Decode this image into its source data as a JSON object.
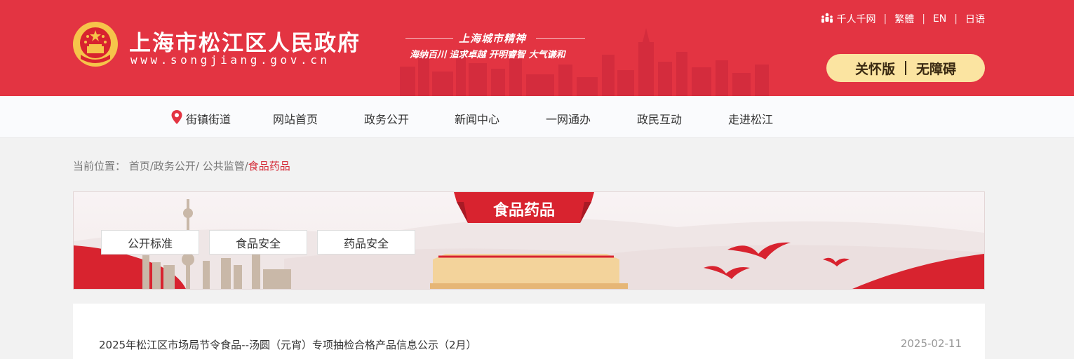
{
  "header": {
    "site_name": "上海市松江区人民政府",
    "site_url": "www.songjiang.gov.cn",
    "slogan_title": "上海城市精神",
    "slogan_text": "海纳百川  追求卓越  开明睿智  大气谦和",
    "top_links": {
      "thousand_people": "千人千网",
      "traditional": "繁體",
      "english": "EN",
      "japanese": "日语"
    },
    "care_mode": "关怀版",
    "accessible": "无障碍",
    "colors": {
      "header_bg": "#e33442",
      "pill_bg": "#fbe4a1"
    }
  },
  "nav": {
    "items": [
      {
        "label": "街镇街道",
        "icon": "location-pin-icon"
      },
      {
        "label": "网站首页"
      },
      {
        "label": "政务公开"
      },
      {
        "label": "新闻中心"
      },
      {
        "label": "一网通办"
      },
      {
        "label": "政民互动"
      },
      {
        "label": "走进松江"
      }
    ]
  },
  "breadcrumb": {
    "prefix": "当前位置：",
    "home": "首页",
    "level1": "政务公开",
    "level2": "公共监管",
    "current": "食品药品"
  },
  "banner": {
    "title": "食品药品",
    "chips": [
      "公开标准",
      "食品安全",
      "药品安全"
    ]
  },
  "list": {
    "items": [
      {
        "title": "2025年松江区市场局节令食品--汤圆（元宵）专项抽检合格产品信息公示（2月）",
        "date": "2025-02-11"
      }
    ]
  }
}
